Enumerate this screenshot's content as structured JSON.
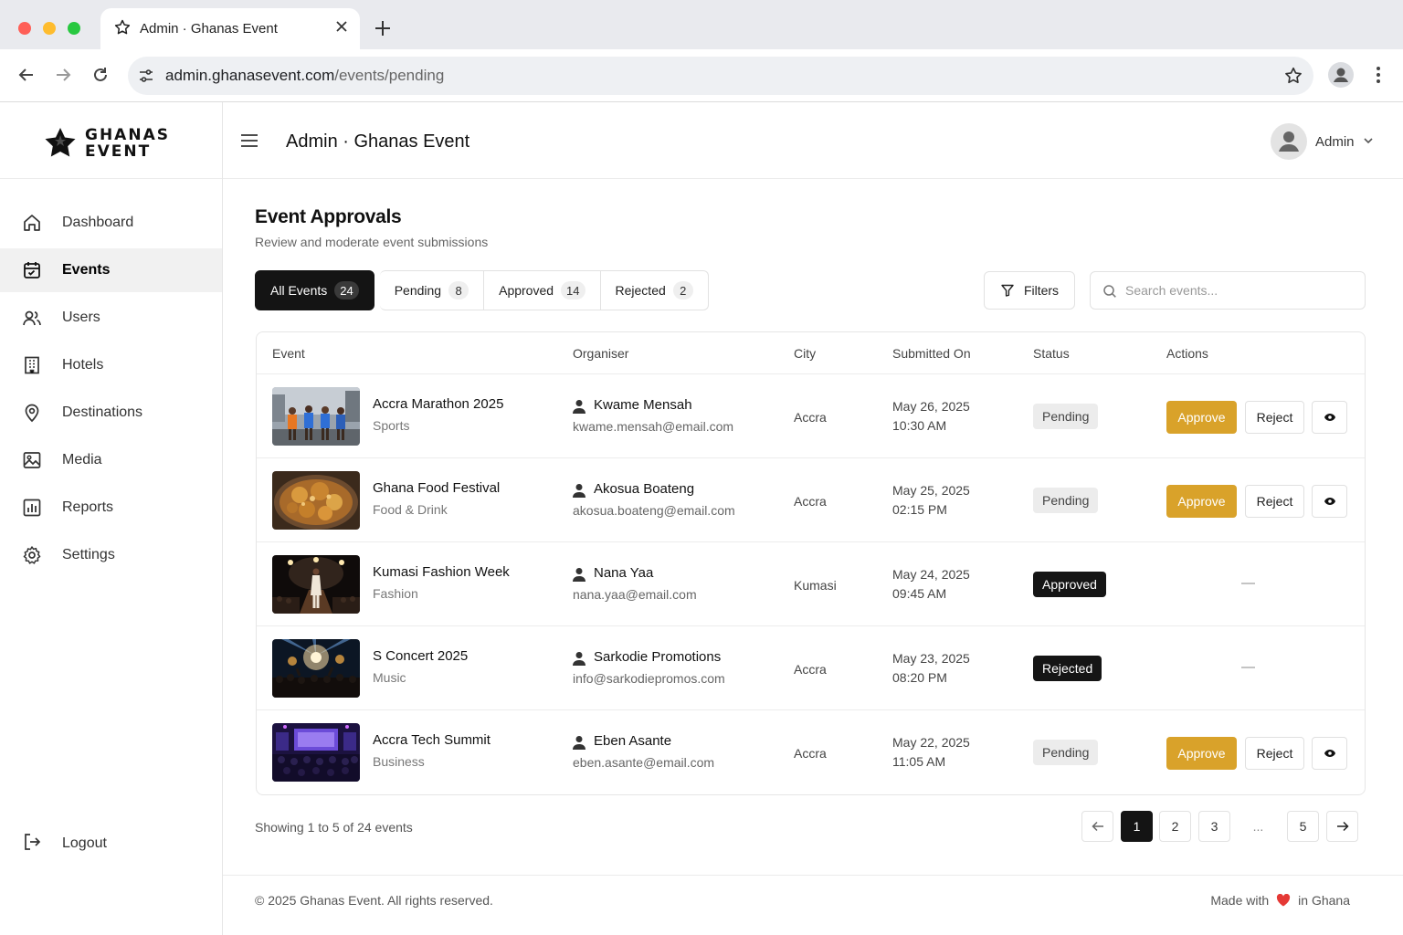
{
  "browser": {
    "tab_title": "Admin · Ghanas Event",
    "url_domain": "admin.ghanasevent.com",
    "url_path": "/events/pending"
  },
  "brand": {
    "line1": "GHANAS",
    "line2": "EVENT"
  },
  "sidebar": {
    "items": [
      {
        "label": "Dashboard",
        "icon": "home-icon",
        "active": false
      },
      {
        "label": "Events",
        "icon": "calendar-icon",
        "active": true
      },
      {
        "label": "Users",
        "icon": "users-icon",
        "active": false
      },
      {
        "label": "Hotels",
        "icon": "building-icon",
        "active": false
      },
      {
        "label": "Destinations",
        "icon": "map-pin-icon",
        "active": false
      },
      {
        "label": "Media",
        "icon": "image-icon",
        "active": false
      },
      {
        "label": "Reports",
        "icon": "bar-chart-icon",
        "active": false
      },
      {
        "label": "Settings",
        "icon": "gear-icon",
        "active": false
      }
    ],
    "logout_label": "Logout"
  },
  "header": {
    "title": "Admin · Ghanas Event",
    "user_name": "Admin"
  },
  "page": {
    "title": "Event Approvals",
    "subtitle": "Review and moderate event submissions"
  },
  "filter_tabs": [
    {
      "label": "All Events",
      "count": "24",
      "active": true
    },
    {
      "label": "Pending",
      "count": "8",
      "active": false
    },
    {
      "label": "Approved",
      "count": "14",
      "active": false
    },
    {
      "label": "Rejected",
      "count": "2",
      "active": false
    }
  ],
  "filters_label": "Filters",
  "search": {
    "placeholder": "Search events...",
    "value": ""
  },
  "table": {
    "columns": [
      "Event",
      "Organiser",
      "City",
      "Submitted On",
      "Status",
      "Actions"
    ],
    "rows": [
      {
        "name": "Accra Marathon 2025",
        "category": "Sports",
        "organiser": "Kwame Mensah",
        "email": "kwame.mensah@email.com",
        "city": "Accra",
        "date": "May 26, 2025",
        "time": "10:30 AM",
        "status": "Pending"
      },
      {
        "name": "Ghana Food Festival",
        "category": "Food & Drink",
        "organiser": "Akosua Boateng",
        "email": "akosua.boateng@email.com",
        "city": "Accra",
        "date": "May 25, 2025",
        "time": "02:15 PM",
        "status": "Pending"
      },
      {
        "name": "Kumasi Fashion Week",
        "category": "Fashion",
        "organiser": "Nana Yaa",
        "email": "nana.yaa@email.com",
        "city": "Kumasi",
        "date": "May 24, 2025",
        "time": "09:45 AM",
        "status": "Approved"
      },
      {
        "name": "S Concert 2025",
        "category": "Music",
        "organiser": "Sarkodie Promotions",
        "email": "info@sarkodiepromos.com",
        "city": "Accra",
        "date": "May 23, 2025",
        "time": "08:20 PM",
        "status": "Rejected"
      },
      {
        "name": "Accra Tech Summit",
        "category": "Business",
        "organiser": "Eben Asante",
        "email": "eben.asante@email.com",
        "city": "Accra",
        "date": "May 22, 2025",
        "time": "11:05 AM",
        "status": "Pending"
      }
    ],
    "approve_label": "Approve",
    "reject_label": "Reject",
    "no_action": "—"
  },
  "pagination": {
    "showing": "Showing 1 to 5 of 24 events",
    "pages": [
      "1",
      "2",
      "3",
      "...",
      "5"
    ],
    "current": "1"
  },
  "footer": {
    "copyright": "© 2025 Ghanas Event. All rights reserved.",
    "made_with": "Made with",
    "in_ghana": "in Ghana"
  },
  "colors": {
    "accent": "#d9a22a",
    "dark": "#141414",
    "heart": "#e53935"
  }
}
